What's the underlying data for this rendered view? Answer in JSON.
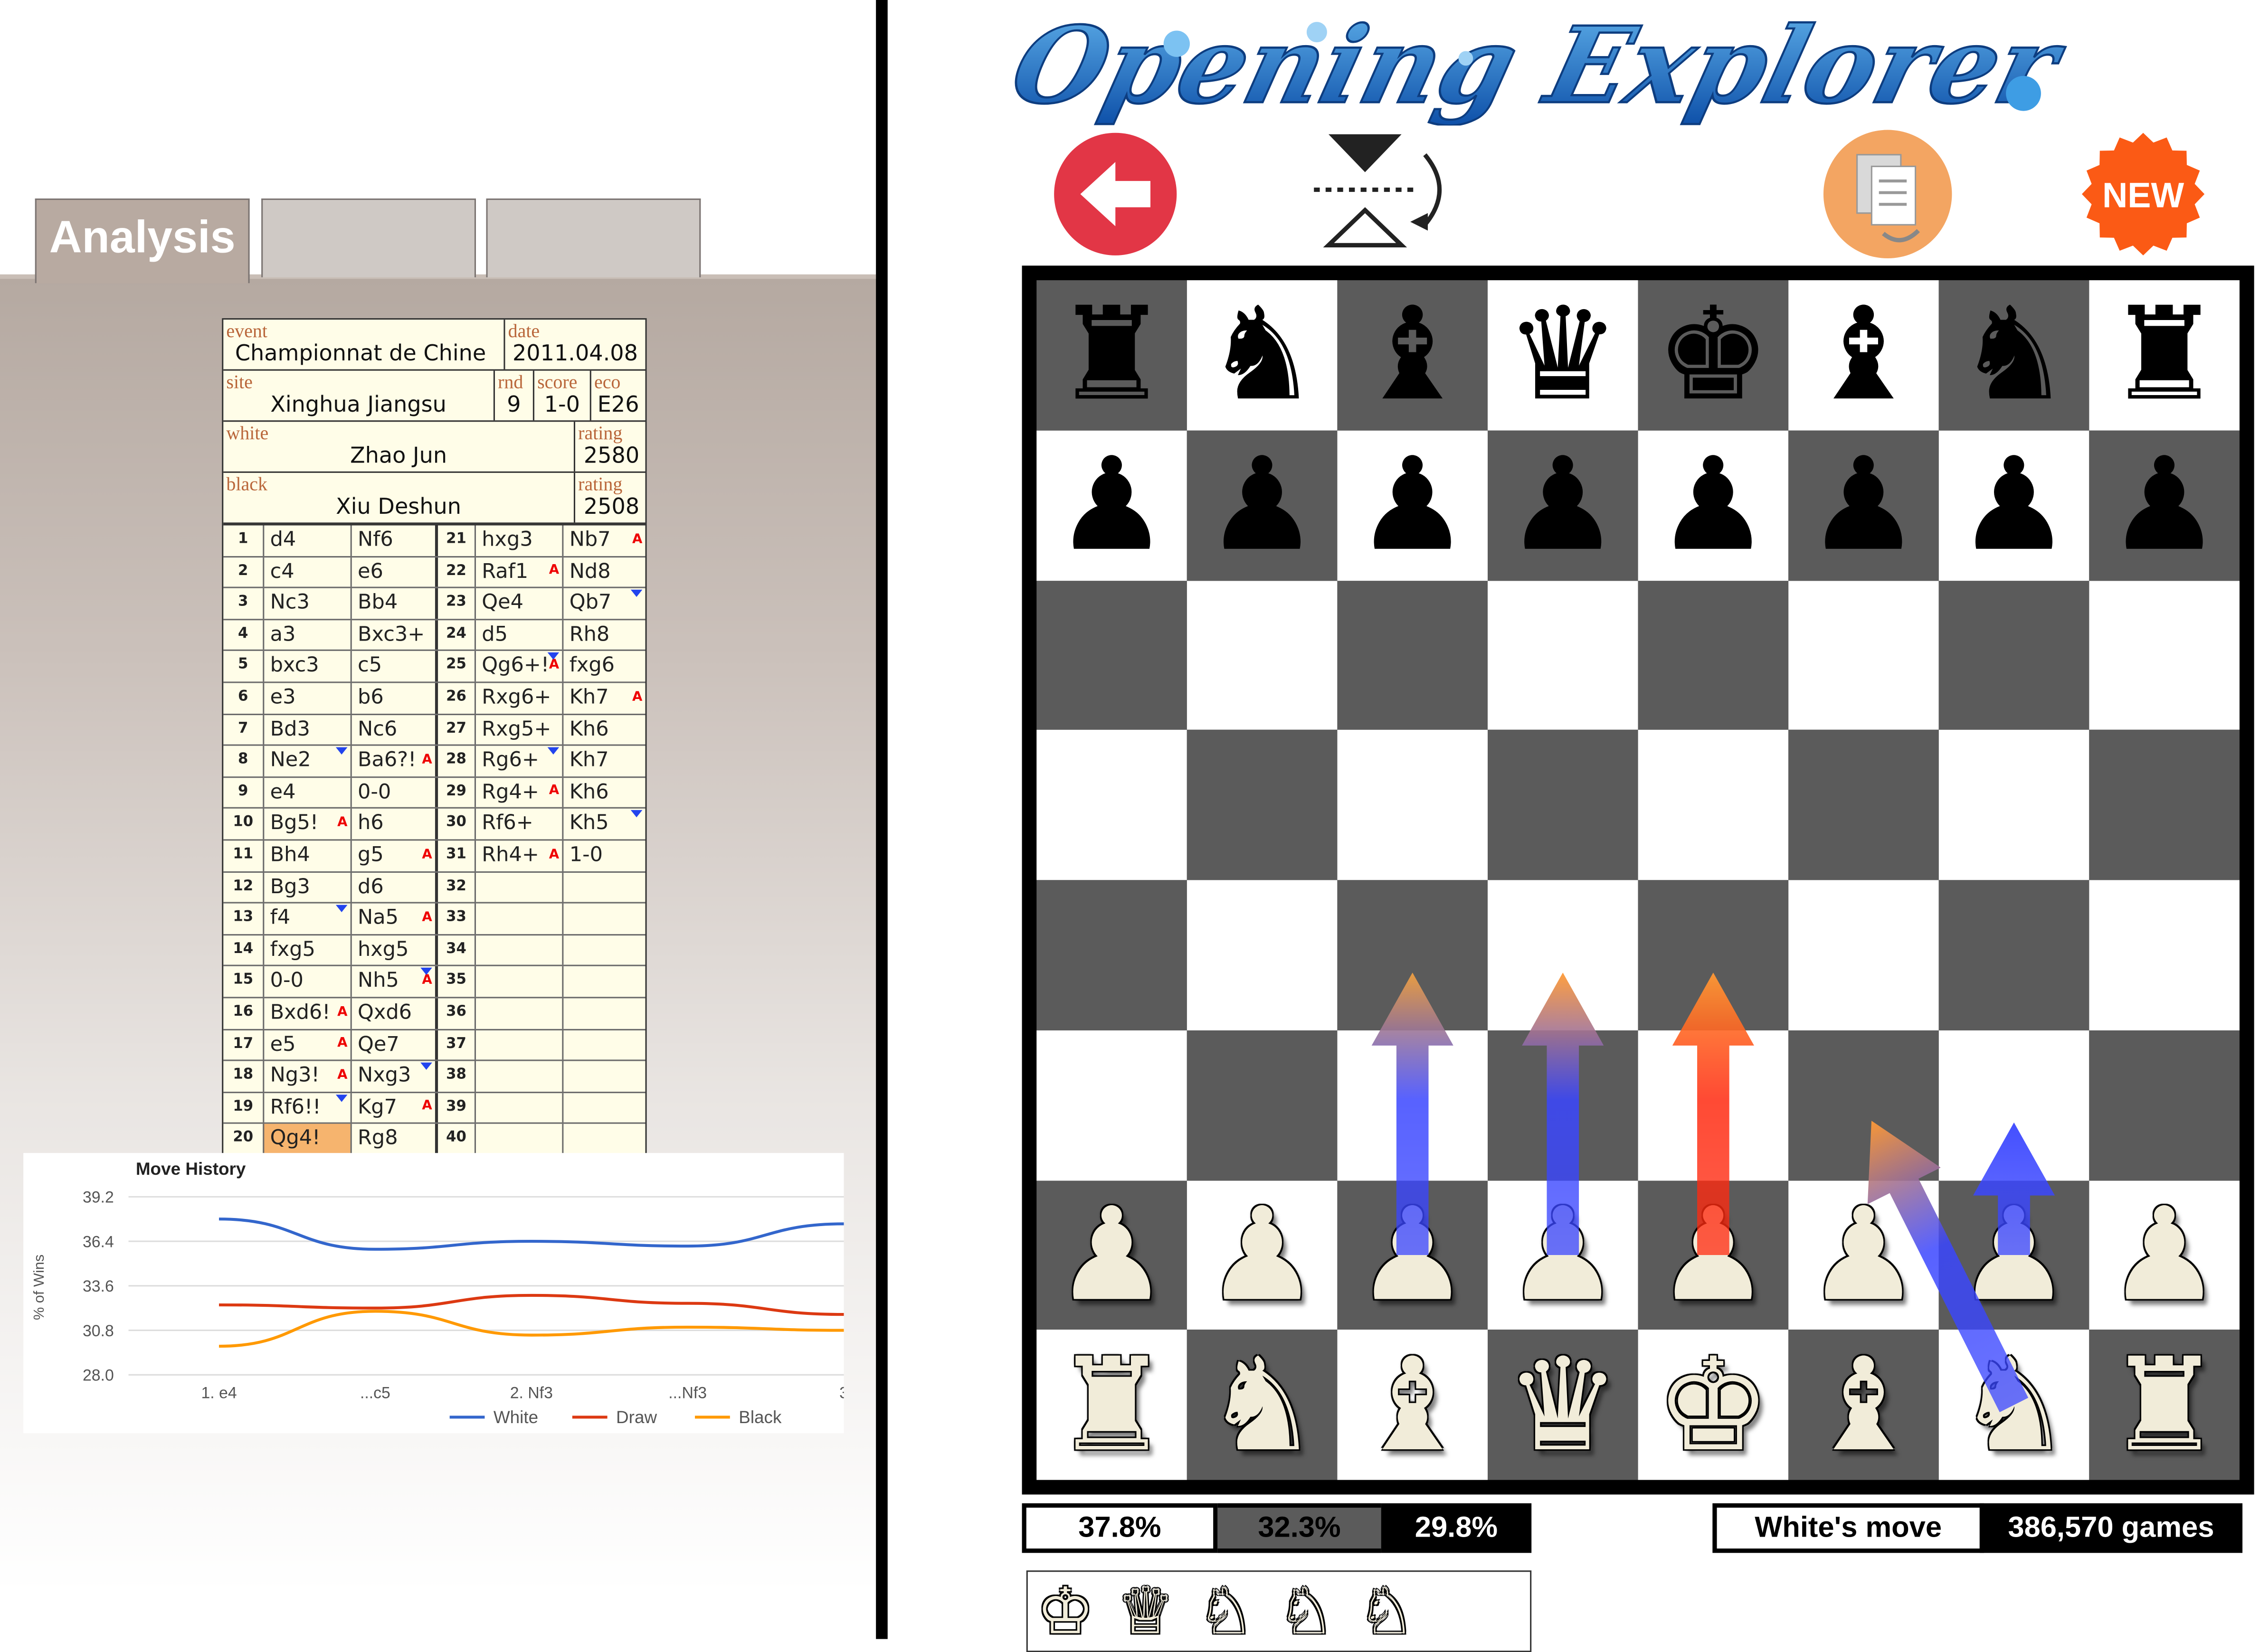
{
  "app": {
    "title": "Opening Explorer"
  },
  "tabs": [
    {
      "label": "Analysis",
      "active": true
    },
    {
      "label": ""
    },
    {
      "label": ""
    }
  ],
  "game": {
    "event_label": "event",
    "event": "Championnat de Chine",
    "date_label": "date",
    "date": "2011.04.08",
    "site_label": "site",
    "site": "Xinghua Jiangsu",
    "round_label": "rnd",
    "round": "9",
    "score_label": "score",
    "score": "1-0",
    "eco_label": "eco",
    "eco": "E26",
    "white_label": "white",
    "white": "Zhao Jun",
    "white_rating_label": "rating",
    "white_rating": "2580",
    "black_label": "black",
    "black": "Xiu Deshun",
    "black_rating_label": "rating",
    "black_rating": "2508"
  },
  "moves": [
    {
      "n": "1",
      "w": "d4",
      "b": "Nf6"
    },
    {
      "n": "2",
      "w": "c4",
      "b": "e6"
    },
    {
      "n": "3",
      "w": "Nc3",
      "b": "Bb4"
    },
    {
      "n": "4",
      "w": "a3",
      "b": "Bxc3+"
    },
    {
      "n": "5",
      "w": "bxc3",
      "b": "c5"
    },
    {
      "n": "6",
      "w": "e3",
      "b": "b6"
    },
    {
      "n": "7",
      "w": "Bd3",
      "b": "Nc6"
    },
    {
      "n": "8",
      "w": "Ne2",
      "b": "Ba6?!"
    },
    {
      "n": "9",
      "w": "e4",
      "b": "0-0"
    },
    {
      "n": "10",
      "w": "Bg5!",
      "b": "h6"
    },
    {
      "n": "11",
      "w": "Bh4",
      "b": "g5"
    },
    {
      "n": "12",
      "w": "Bg3",
      "b": "d6"
    },
    {
      "n": "13",
      "w": "f4",
      "b": "Na5"
    },
    {
      "n": "14",
      "w": "fxg5",
      "b": "hxg5"
    },
    {
      "n": "15",
      "w": "0-0",
      "b": "Nh5"
    },
    {
      "n": "16",
      "w": "Bxd6!",
      "b": "Qxd6"
    },
    {
      "n": "17",
      "w": "e5",
      "b": "Qe7"
    },
    {
      "n": "18",
      "w": "Ng3!",
      "b": "Nxg3"
    },
    {
      "n": "19",
      "w": "Rf6!!",
      "b": "Kg7"
    },
    {
      "n": "20",
      "w": "Qg4!",
      "b": "Rg8"
    },
    {
      "n": "21",
      "w": "hxg3",
      "b": "Nb7"
    },
    {
      "n": "22",
      "w": "Raf1",
      "b": "Nd8"
    },
    {
      "n": "23",
      "w": "Qe4",
      "b": "Qb7"
    },
    {
      "n": "24",
      "w": "d5",
      "b": "Rh8"
    },
    {
      "n": "25",
      "w": "Qg6+!",
      "b": "fxg6"
    },
    {
      "n": "26",
      "w": "Rxg6+",
      "b": "Kh7"
    },
    {
      "n": "27",
      "w": "Rxg5+",
      "b": "Kh6"
    },
    {
      "n": "28",
      "w": "Rg6+",
      "b": "Kh7"
    },
    {
      "n": "29",
      "w": "Rg4+",
      "b": "Kh6"
    },
    {
      "n": "30",
      "w": "Rf6+",
      "b": "Kh5"
    },
    {
      "n": "31",
      "w": "Rh4+",
      "b": "1-0"
    },
    {
      "n": "32",
      "w": "",
      "b": ""
    },
    {
      "n": "33",
      "w": "",
      "b": ""
    },
    {
      "n": "34",
      "w": "",
      "b": ""
    },
    {
      "n": "35",
      "w": "",
      "b": ""
    },
    {
      "n": "36",
      "w": "",
      "b": ""
    },
    {
      "n": "37",
      "w": "",
      "b": ""
    },
    {
      "n": "38",
      "w": "",
      "b": ""
    },
    {
      "n": "39",
      "w": "",
      "b": ""
    },
    {
      "n": "40",
      "w": "",
      "b": ""
    }
  ],
  "chart_data": {
    "type": "line",
    "title": "Move History",
    "ylabel": "% of Wins",
    "xlabel": "",
    "categories": [
      "1. e4",
      "...c5",
      "2. Nf3",
      "...Nf3",
      "3"
    ],
    "y_ticks": [
      "39.2",
      "36.4",
      "33.6",
      "30.8",
      "28.0"
    ],
    "ylim": [
      28.0,
      39.2
    ],
    "grid": true,
    "legend_position": "bottom-right",
    "series": [
      {
        "name": "White",
        "color": "#3366cc",
        "values": [
          37.8,
          35.9,
          36.4,
          36.1,
          37.5
        ]
      },
      {
        "name": "Draw",
        "color": "#dc3912",
        "values": [
          32.4,
          32.2,
          33.0,
          32.5,
          31.8
        ]
      },
      {
        "name": "Black",
        "color": "#ff9900",
        "values": [
          29.8,
          32.0,
          30.5,
          31.0,
          30.8
        ]
      }
    ]
  },
  "toolbar": {
    "back_icon": "back-arrow-icon",
    "flip_icon": "flip-board-icon",
    "copy_icon": "copy-pgn-icon",
    "new_label": "NEW"
  },
  "board": {
    "light_color": "#ffffff",
    "dark_color": "#5b5b5b",
    "position": [
      [
        "r",
        "n",
        "b",
        "q",
        "k",
        "b",
        "n",
        "r"
      ],
      [
        "p",
        "p",
        "p",
        "p",
        "p",
        "p",
        "p",
        "p"
      ],
      [
        "",
        "",
        "",
        "",
        "",
        "",
        "",
        ""
      ],
      [
        "",
        "",
        "",
        "",
        "",
        "",
        "",
        ""
      ],
      [
        "",
        "",
        "",
        "",
        "",
        "",
        "",
        ""
      ],
      [
        "",
        "",
        "",
        "",
        "",
        "",
        "",
        ""
      ],
      [
        "P",
        "P",
        "P",
        "P",
        "P",
        "P",
        "P",
        "P"
      ],
      [
        "R",
        "N",
        "B",
        "Q",
        "K",
        "B",
        "N",
        "R"
      ]
    ],
    "move_arrows": [
      {
        "from": "c2",
        "to": "c4"
      },
      {
        "from": "d2",
        "to": "d4"
      },
      {
        "from": "e2",
        "to": "e4"
      },
      {
        "from": "g1",
        "to": "f3"
      },
      {
        "from": "g2",
        "to": "g3"
      }
    ]
  },
  "stats": {
    "white_pct": "37.8%",
    "draw_pct": "32.3%",
    "black_pct": "29.8%",
    "to_move": "White's move",
    "games": "386,570 games"
  },
  "captured_pieces": [
    "K",
    "Q",
    "N",
    "N",
    "N"
  ]
}
